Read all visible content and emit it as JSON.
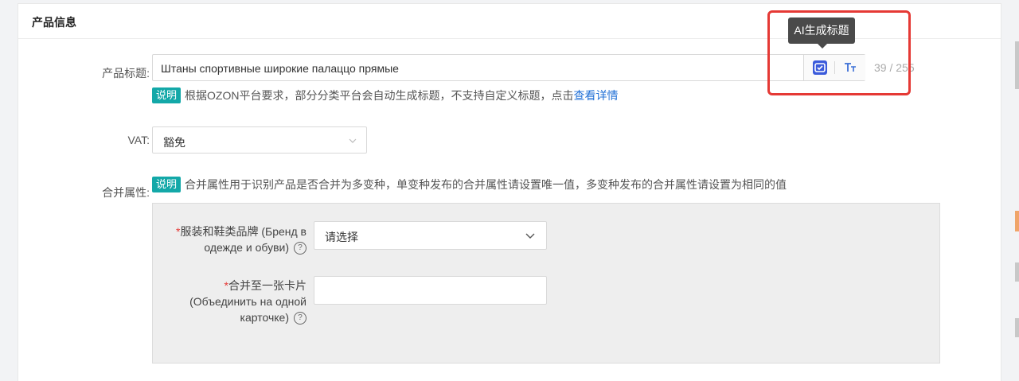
{
  "section": {
    "title": "产品信息"
  },
  "title_field": {
    "label": "产品标题:",
    "value": "Штаны спортивные широкие палаццо прямые",
    "counter": "39 / 255",
    "tooltip": "AI生成标题"
  },
  "title_note": {
    "badge": "说明",
    "text": "根据OZON平台要求，部分分类平台会自动生成标题，不支持自定义标题，点击",
    "link": "查看详情"
  },
  "vat_field": {
    "label": "VAT:",
    "value": "豁免"
  },
  "merge_attr": {
    "label": "合并属性:",
    "badge": "说明",
    "note": "合并属性用于识别产品是否合并为多变种，单变种发布的合并属性请设置唯一值，多变种发布的合并属性请设置为相同的值",
    "brand": {
      "required_mark": "*",
      "label_line1": "服装和鞋类品牌 (Бренд в",
      "label_line2": "одежде и обуви)",
      "help": "?",
      "placeholder": "请选择"
    },
    "combine_card": {
      "required_mark": "*",
      "label_line1": "合并至一张卡片",
      "label_line2": "(Объединить на одной",
      "label_line3": "карточке)",
      "help": "?",
      "value": ""
    }
  },
  "colors": {
    "badge": "#13a8a8",
    "link": "#1f6fd6",
    "highlight": "#e53935",
    "ai_button": "#3b5bdb",
    "tooltip_bg": "#4a4a4a"
  }
}
